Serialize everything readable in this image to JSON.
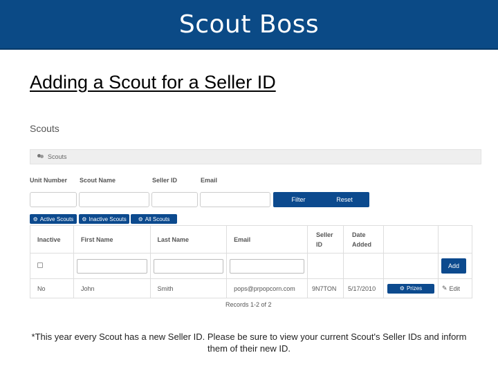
{
  "slide": {
    "title": "Scout Boss",
    "subtitle": "Adding a Scout for a Seller ID",
    "footnote": "*This year every Scout has a new Seller ID.  Please be sure to view your current Scout's Seller IDs and inform them of their new ID."
  },
  "app": {
    "heading": "Scouts",
    "panel_label": "Scouts",
    "filters": {
      "unit_number_label": "Unit Number",
      "scout_name_label": "Scout Name",
      "seller_id_label": "Seller ID",
      "email_label": "Email",
      "filter_button": "Filter",
      "reset_button": "Reset"
    },
    "tabs": [
      "Active Scouts",
      "Inactive Scouts",
      "All Scouts"
    ],
    "table": {
      "headers": {
        "inactive": "Inactive",
        "first_name": "First Name",
        "last_name": "Last Name",
        "email": "Email",
        "seller_id_1": "Seller",
        "seller_id_2": "ID",
        "date_added_1": "Date",
        "date_added_2": "Added"
      },
      "add_button": "Add",
      "rows": [
        {
          "inactive": "No",
          "first_name": "John",
          "last_name": "Smith",
          "email": "pops@prpopcorn.com",
          "seller_id": "9N7TON",
          "date_added": "5/17/2010",
          "prizes_button": "Prizes",
          "edit_link": "Edit"
        }
      ]
    },
    "records_text": "Records 1-2 of 2"
  },
  "colors": {
    "title_bar": "#0b4a86",
    "button": "#0c4a8e"
  },
  "icons": {
    "panel": "users-icon",
    "tabs": "gear-icon",
    "prizes": "gear-icon",
    "edit": "pencil-icon"
  }
}
